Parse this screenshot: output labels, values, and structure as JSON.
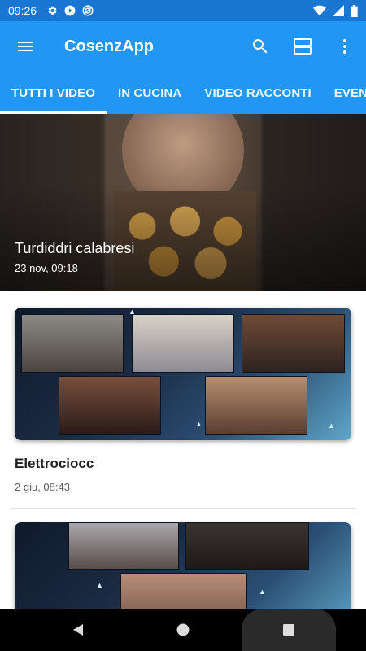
{
  "status_bar": {
    "time": "09:26",
    "icons_left": [
      "gear-icon",
      "play-icon",
      "cast-icon"
    ],
    "icons_right": [
      "wifi-icon",
      "signal-icon",
      "battery-icon"
    ]
  },
  "app_bar": {
    "title": "CosenzApp",
    "actions": [
      "search-icon",
      "view-list-icon",
      "more-vert-icon"
    ],
    "color": "#2196f3",
    "status_color": "#1976d2"
  },
  "tabs": [
    {
      "label": "TUTTI I VIDEO",
      "active": true
    },
    {
      "label": "IN CUCINA",
      "active": false
    },
    {
      "label": "VIDEO RACCONTI",
      "active": false
    },
    {
      "label": "EVENTI",
      "active": false
    }
  ],
  "featured": {
    "title": "Turdiddri calabresi",
    "date": "23 nov, 09:18"
  },
  "videos": [
    {
      "title": "Elettrociocc",
      "date": "2 giu, 08:43"
    },
    {
      "title": "",
      "date": ""
    }
  ],
  "nav_bar": [
    "back-icon",
    "home-icon",
    "recents-icon"
  ]
}
